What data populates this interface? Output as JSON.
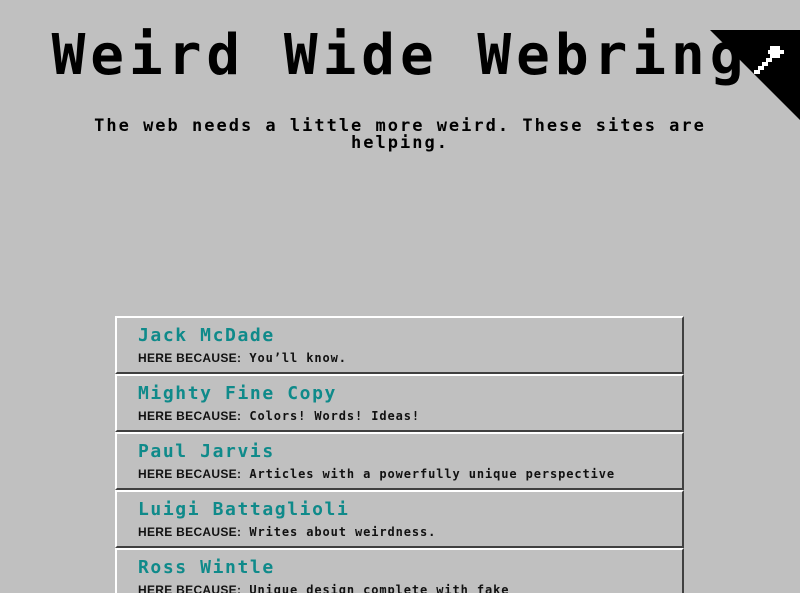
{
  "header": {
    "title": "Weird Wide Webring",
    "tagline": "The web needs a little more weird. These sites are helping."
  },
  "corner": {
    "icon": "wrench-icon"
  },
  "sites": [
    {
      "name": "Jack McDade",
      "reason_label": "HERE BECAUSE:",
      "reason": "You’ll know."
    },
    {
      "name": "Mighty Fine Copy",
      "reason_label": "HERE BECAUSE:",
      "reason": "Colors! Words! Ideas!"
    },
    {
      "name": "Paul Jarvis",
      "reason_label": "HERE BECAUSE:",
      "reason": "Articles with a powerfully unique perspective"
    },
    {
      "name": "Luigi Battaglioli",
      "reason_label": "HERE BECAUSE:",
      "reason": "Writes about weirdness."
    },
    {
      "name": "Ross Wintle",
      "reason_label": "HERE BECAUSE:",
      "reason": "Unique design complete with fake"
    }
  ],
  "colors": {
    "background": "#c0c0c0",
    "link": "#0f8a8a",
    "text": "#000000"
  }
}
